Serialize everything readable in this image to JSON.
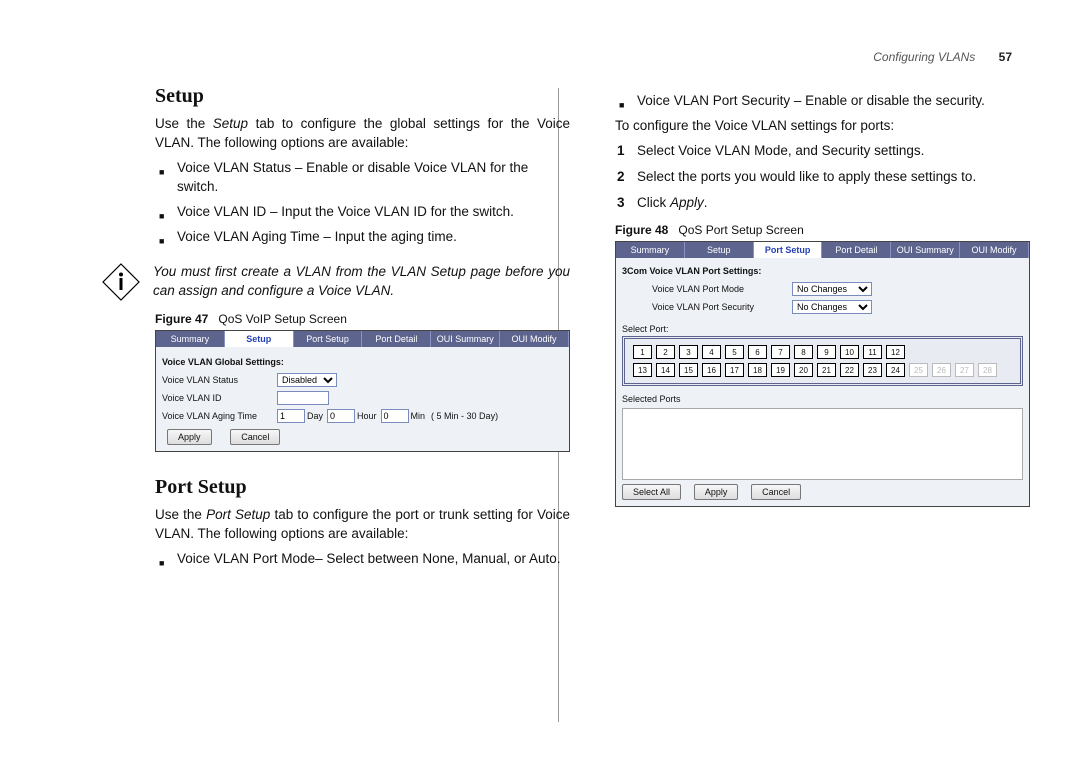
{
  "header": {
    "running_title": "Configuring VLANs",
    "page_number": "57"
  },
  "left": {
    "h_setup": "Setup",
    "p_setup_intro_a": "Use the ",
    "p_setup_intro_em": "Setup",
    "p_setup_intro_b": " tab to configure the global settings for the Voice VLAN. The following options are available:",
    "bullets_setup": [
      "Voice VLAN Status – Enable or disable Voice VLAN for the switch.",
      "Voice VLAN ID – Input the Voice VLAN ID for the switch.",
      "Voice VLAN Aging Time – Input the aging time."
    ],
    "note": "You must first create a VLAN from the VLAN Setup page before you can assign and configure a Voice VLAN.",
    "fig47_label": "Figure 47",
    "fig47_caption": "QoS VoIP Setup Screen",
    "h_portsetup": "Port Setup",
    "p_portsetup_intro_a": "Use the ",
    "p_portsetup_intro_em": "Port Setup",
    "p_portsetup_intro_b": " tab to configure the port or trunk setting for Voice VLAN. The following options are available:",
    "bullets_portsetup": [
      "Voice VLAN Port Mode– Select between None, Manual, or Auto."
    ]
  },
  "right": {
    "bullets_cont": [
      "Voice VLAN Port Security – Enable or disable the security."
    ],
    "p_configure": "To configure the Voice VLAN settings for ports:",
    "steps": [
      "Select Voice VLAN Mode, and Security settings.",
      "Select the ports you would like to apply these settings to."
    ],
    "step3_a": "Click ",
    "step3_em": "Apply",
    "step3_b": ".",
    "fig48_label": "Figure 48",
    "fig48_caption": "QoS Port Setup Screen"
  },
  "fig47": {
    "tabs": [
      "Summary",
      "Setup",
      "Port Setup",
      "Port Detail",
      "OUI Summary",
      "OUI Modify"
    ],
    "active_tab_index": 1,
    "section_title": "Voice VLAN Global Settings:",
    "row1_label": "Voice VLAN Status",
    "row1_value": "Disabled",
    "row2_label": "Voice VLAN ID",
    "row3_label": "Voice VLAN Aging Time",
    "row3_day_val": "1",
    "row3_day_unit": "Day",
    "row3_hour_val": "0",
    "row3_hour_unit": "Hour",
    "row3_min_val": "0",
    "row3_min_unit": "Min",
    "row3_range": "( 5 Min - 30 Day)",
    "btn_apply": "Apply",
    "btn_cancel": "Cancel"
  },
  "fig48": {
    "tabs": [
      "Summary",
      "Setup",
      "Port Setup",
      "Port Detail",
      "OUI Summary",
      "OUI Modify"
    ],
    "active_tab_index": 2,
    "section_title": "3Com Voice VLAN Port Settings:",
    "row1_label": "Voice VLAN Port Mode",
    "row1_value": "No Changes",
    "row2_label": "Voice VLAN Port Security",
    "row2_value": "No Changes",
    "selectport_label": "Select Port:",
    "ports_row1": [
      "1",
      "2",
      "3",
      "4",
      "5",
      "6",
      "7",
      "8",
      "9",
      "10",
      "11",
      "12"
    ],
    "ports_row2": [
      "13",
      "14",
      "15",
      "16",
      "17",
      "18",
      "19",
      "20",
      "21",
      "22",
      "23",
      "24",
      "25",
      "26",
      "27",
      "28"
    ],
    "dim_ports": [
      "25",
      "26",
      "27",
      "28"
    ],
    "selected_ports_label": "Selected Ports",
    "btn_selectall": "Select All",
    "btn_apply": "Apply",
    "btn_cancel": "Cancel"
  }
}
